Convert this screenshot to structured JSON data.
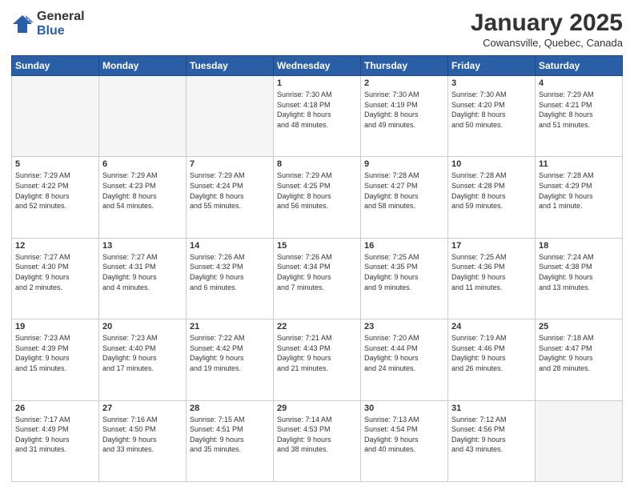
{
  "logo": {
    "general": "General",
    "blue": "Blue"
  },
  "header": {
    "month": "January 2025",
    "location": "Cowansville, Quebec, Canada"
  },
  "weekdays": [
    "Sunday",
    "Monday",
    "Tuesday",
    "Wednesday",
    "Thursday",
    "Friday",
    "Saturday"
  ],
  "weeks": [
    [
      {
        "day": "",
        "info": ""
      },
      {
        "day": "",
        "info": ""
      },
      {
        "day": "",
        "info": ""
      },
      {
        "day": "1",
        "info": "Sunrise: 7:30 AM\nSunset: 4:18 PM\nDaylight: 8 hours\nand 48 minutes."
      },
      {
        "day": "2",
        "info": "Sunrise: 7:30 AM\nSunset: 4:19 PM\nDaylight: 8 hours\nand 49 minutes."
      },
      {
        "day": "3",
        "info": "Sunrise: 7:30 AM\nSunset: 4:20 PM\nDaylight: 8 hours\nand 50 minutes."
      },
      {
        "day": "4",
        "info": "Sunrise: 7:29 AM\nSunset: 4:21 PM\nDaylight: 8 hours\nand 51 minutes."
      }
    ],
    [
      {
        "day": "5",
        "info": "Sunrise: 7:29 AM\nSunset: 4:22 PM\nDaylight: 8 hours\nand 52 minutes."
      },
      {
        "day": "6",
        "info": "Sunrise: 7:29 AM\nSunset: 4:23 PM\nDaylight: 8 hours\nand 54 minutes."
      },
      {
        "day": "7",
        "info": "Sunrise: 7:29 AM\nSunset: 4:24 PM\nDaylight: 8 hours\nand 55 minutes."
      },
      {
        "day": "8",
        "info": "Sunrise: 7:29 AM\nSunset: 4:25 PM\nDaylight: 8 hours\nand 56 minutes."
      },
      {
        "day": "9",
        "info": "Sunrise: 7:28 AM\nSunset: 4:27 PM\nDaylight: 8 hours\nand 58 minutes."
      },
      {
        "day": "10",
        "info": "Sunrise: 7:28 AM\nSunset: 4:28 PM\nDaylight: 8 hours\nand 59 minutes."
      },
      {
        "day": "11",
        "info": "Sunrise: 7:28 AM\nSunset: 4:29 PM\nDaylight: 9 hours\nand 1 minute."
      }
    ],
    [
      {
        "day": "12",
        "info": "Sunrise: 7:27 AM\nSunset: 4:30 PM\nDaylight: 9 hours\nand 2 minutes."
      },
      {
        "day": "13",
        "info": "Sunrise: 7:27 AM\nSunset: 4:31 PM\nDaylight: 9 hours\nand 4 minutes."
      },
      {
        "day": "14",
        "info": "Sunrise: 7:26 AM\nSunset: 4:32 PM\nDaylight: 9 hours\nand 6 minutes."
      },
      {
        "day": "15",
        "info": "Sunrise: 7:26 AM\nSunset: 4:34 PM\nDaylight: 9 hours\nand 7 minutes."
      },
      {
        "day": "16",
        "info": "Sunrise: 7:25 AM\nSunset: 4:35 PM\nDaylight: 9 hours\nand 9 minutes."
      },
      {
        "day": "17",
        "info": "Sunrise: 7:25 AM\nSunset: 4:36 PM\nDaylight: 9 hours\nand 11 minutes."
      },
      {
        "day": "18",
        "info": "Sunrise: 7:24 AM\nSunset: 4:38 PM\nDaylight: 9 hours\nand 13 minutes."
      }
    ],
    [
      {
        "day": "19",
        "info": "Sunrise: 7:23 AM\nSunset: 4:39 PM\nDaylight: 9 hours\nand 15 minutes."
      },
      {
        "day": "20",
        "info": "Sunrise: 7:23 AM\nSunset: 4:40 PM\nDaylight: 9 hours\nand 17 minutes."
      },
      {
        "day": "21",
        "info": "Sunrise: 7:22 AM\nSunset: 4:42 PM\nDaylight: 9 hours\nand 19 minutes."
      },
      {
        "day": "22",
        "info": "Sunrise: 7:21 AM\nSunset: 4:43 PM\nDaylight: 9 hours\nand 21 minutes."
      },
      {
        "day": "23",
        "info": "Sunrise: 7:20 AM\nSunset: 4:44 PM\nDaylight: 9 hours\nand 24 minutes."
      },
      {
        "day": "24",
        "info": "Sunrise: 7:19 AM\nSunset: 4:46 PM\nDaylight: 9 hours\nand 26 minutes."
      },
      {
        "day": "25",
        "info": "Sunrise: 7:18 AM\nSunset: 4:47 PM\nDaylight: 9 hours\nand 28 minutes."
      }
    ],
    [
      {
        "day": "26",
        "info": "Sunrise: 7:17 AM\nSunset: 4:49 PM\nDaylight: 9 hours\nand 31 minutes."
      },
      {
        "day": "27",
        "info": "Sunrise: 7:16 AM\nSunset: 4:50 PM\nDaylight: 9 hours\nand 33 minutes."
      },
      {
        "day": "28",
        "info": "Sunrise: 7:15 AM\nSunset: 4:51 PM\nDaylight: 9 hours\nand 35 minutes."
      },
      {
        "day": "29",
        "info": "Sunrise: 7:14 AM\nSunset: 4:53 PM\nDaylight: 9 hours\nand 38 minutes."
      },
      {
        "day": "30",
        "info": "Sunrise: 7:13 AM\nSunset: 4:54 PM\nDaylight: 9 hours\nand 40 minutes."
      },
      {
        "day": "31",
        "info": "Sunrise: 7:12 AM\nSunset: 4:56 PM\nDaylight: 9 hours\nand 43 minutes."
      },
      {
        "day": "",
        "info": ""
      }
    ]
  ]
}
